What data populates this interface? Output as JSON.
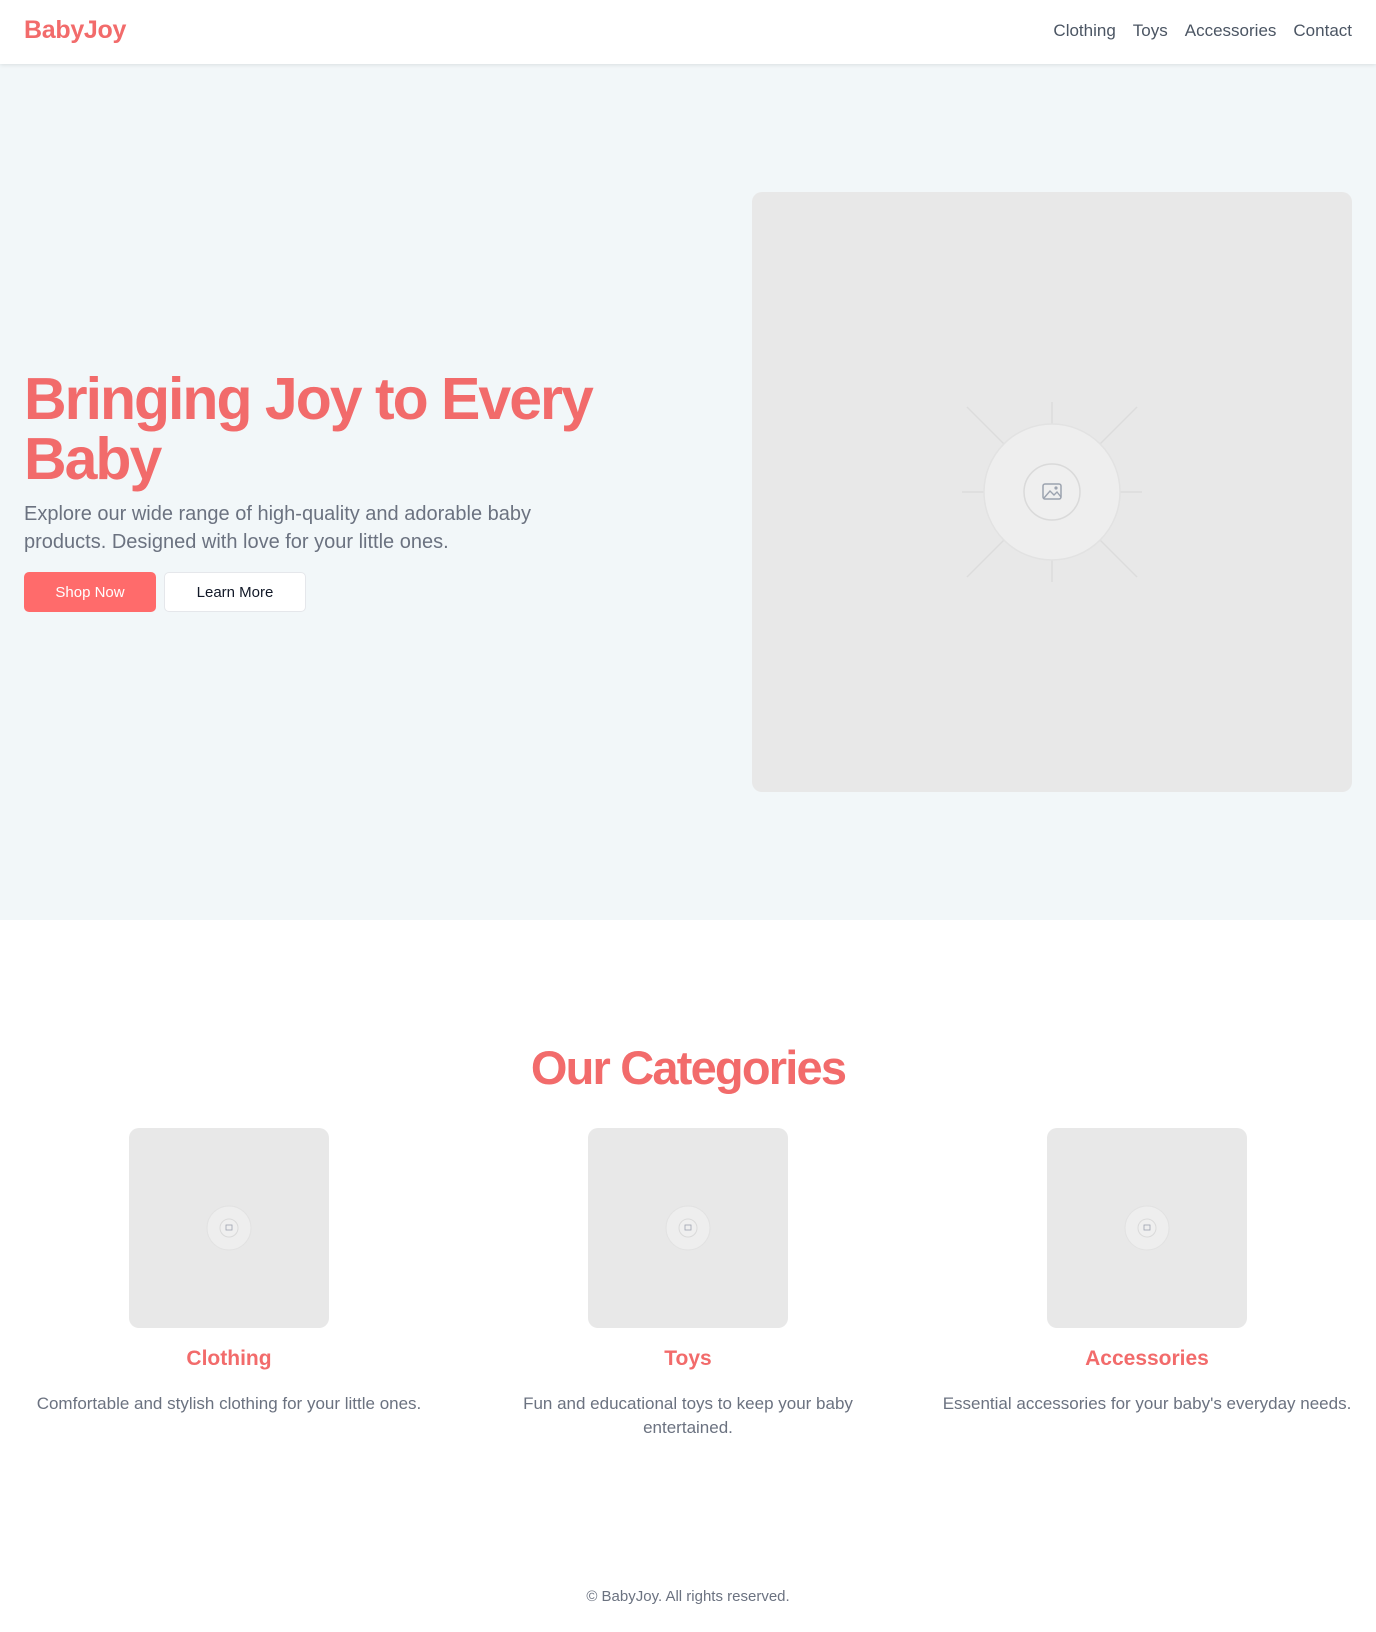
{
  "header": {
    "logo": "BabyJoy",
    "nav": [
      "Clothing",
      "Toys",
      "Accessories",
      "Contact"
    ]
  },
  "hero": {
    "title": "Bringing Joy to Every Baby",
    "subtitle": "Explore our wide range of high-quality and adorable baby products. Designed with love for your little ones.",
    "primary_button": "Shop Now",
    "secondary_button": "Learn More",
    "image_icon": "image-placeholder-icon"
  },
  "categories": {
    "title": "Our Categories",
    "items": [
      {
        "name": "Clothing",
        "description": "Comfortable and stylish clothing for your little ones."
      },
      {
        "name": "Toys",
        "description": "Fun and educational toys to keep your baby entertained."
      },
      {
        "name": "Accessories",
        "description": "Essential accessories for your baby's everyday needs."
      }
    ]
  },
  "footer": {
    "text": "© BabyJoy. All rights reserved."
  },
  "colors": {
    "brand": "#f26b6b",
    "button": "#ff6b6b",
    "hero_bg": "#f2f7f9",
    "placeholder_bg": "#e8e8e8"
  }
}
